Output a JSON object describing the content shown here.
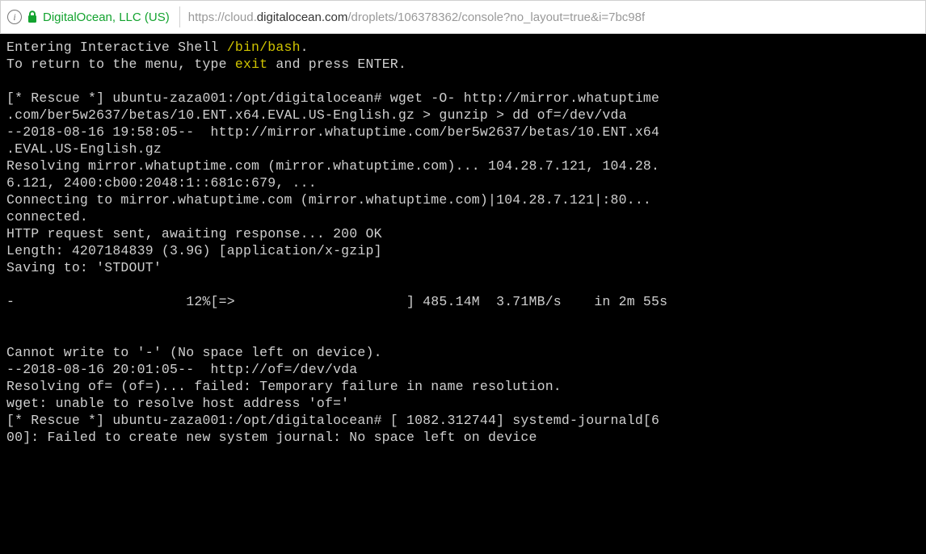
{
  "addressbar": {
    "identity": "DigitalOcean, LLC (US)",
    "url_prefix": "https://cloud.",
    "url_domain": "digitalocean.com",
    "url_suffix": "/droplets/106378362/console?no_layout=true&i=7bc98f"
  },
  "terminal": {
    "l1a": "Entering Interactive Shell ",
    "l1b": "/bin/bash",
    "l1c": ".",
    "l2a": "To return to the menu, type ",
    "l2b": "exit",
    "l2c": " and press ENTER.",
    "blank1": "",
    "l3": "[* Rescue *] ubuntu-zaza001:/opt/digitalocean# wget -O- http://mirror.whatuptime",
    "l4": ".com/ber5w2637/betas/10.ENT.x64.EVAL.US-English.gz > gunzip > dd of=/dev/vda",
    "l5": "--2018-08-16 19:58:05--  http://mirror.whatuptime.com/ber5w2637/betas/10.ENT.x64",
    "l6": ".EVAL.US-English.gz",
    "l7": "Resolving mirror.whatuptime.com (mirror.whatuptime.com)... 104.28.7.121, 104.28.",
    "l8": "6.121, 2400:cb00:2048:1::681c:679, ...",
    "l9": "Connecting to mirror.whatuptime.com (mirror.whatuptime.com)|104.28.7.121|:80...",
    "l10": "connected.",
    "l11": "HTTP request sent, awaiting response... 200 OK",
    "l12": "Length: 4207184839 (3.9G) [application/x-gzip]",
    "l13": "Saving to: 'STDOUT'",
    "blank2": "",
    "l14": "-                     12%[=>                     ] 485.14M  3.71MB/s    in 2m 55s",
    "blank3": "",
    "blank4": "",
    "l15": "Cannot write to '-' (No space left on device).",
    "l16": "--2018-08-16 20:01:05--  http://of=/dev/vda",
    "l17": "Resolving of= (of=)... failed: Temporary failure in name resolution.",
    "l18": "wget: unable to resolve host address 'of='",
    "l19": "[* Rescue *] ubuntu-zaza001:/opt/digitalocean# [ 1082.312744] systemd-journald[6",
    "l20": "00]: Failed to create new system journal: No space left on device"
  }
}
